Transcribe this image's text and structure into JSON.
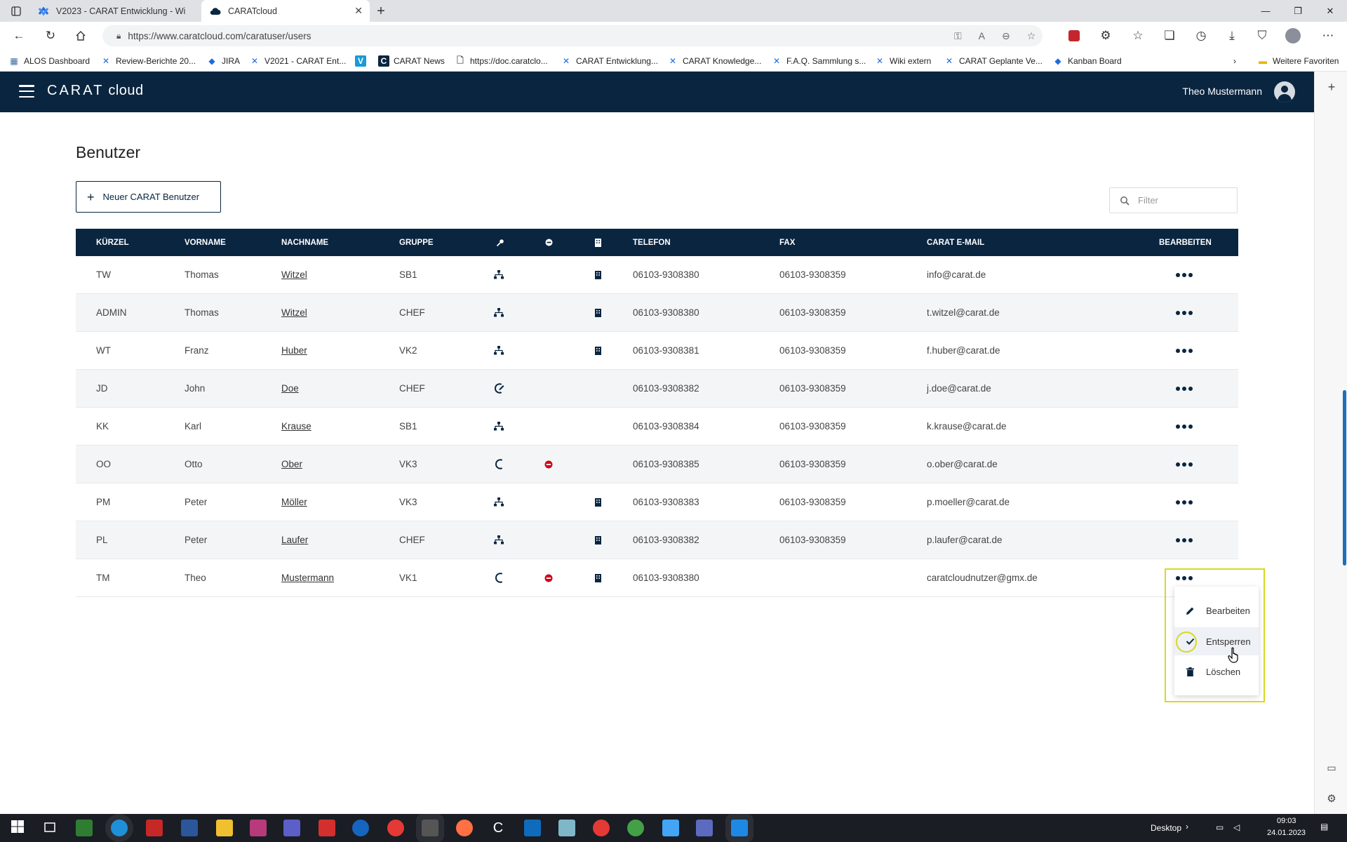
{
  "browser": {
    "tabs": [
      {
        "title": "V2023 - CARAT Entwicklung - Wi",
        "active": false
      },
      {
        "title": "CARATcloud",
        "active": true
      }
    ],
    "url": "https://www.caratcloud.com/caratuser/users",
    "favorites": [
      {
        "label": "ALOS Dashboard"
      },
      {
        "label": "Review-Berichte 20..."
      },
      {
        "label": "JIRA"
      },
      {
        "label": "V2021 - CARAT Ent..."
      },
      {
        "label": "CARAT News"
      },
      {
        "label": "https://doc.caratclo..."
      },
      {
        "label": "CARAT Entwicklung..."
      },
      {
        "label": "CARAT Knowledge..."
      },
      {
        "label": "F.A.Q. Sammlung s..."
      },
      {
        "label": "Wiki extern"
      },
      {
        "label": "CARAT Geplante Ve..."
      },
      {
        "label": "Kanban Board"
      }
    ],
    "other_favorites": "Weitere Favoriten"
  },
  "app": {
    "logo": "CARAT",
    "logo_suffix": "cloud",
    "user_name": "Theo Mustermann"
  },
  "page": {
    "title": "Benutzer",
    "new_button": "Neuer CARAT Benutzer",
    "filter_placeholder": "Filter"
  },
  "table": {
    "headers": {
      "kuerzel": "KÜRZEL",
      "vorname": "VORNAME",
      "nachname": "NACHNAME",
      "gruppe": "GRUPPE",
      "telefon": "TELEFON",
      "fax": "FAX",
      "email": "CARAT E-MAIL",
      "bearbeiten": "BEARBEITEN"
    },
    "rows": [
      {
        "kuerzel": "TW",
        "vorname": "Thomas",
        "nachname": "Witzel",
        "gruppe": "SB1",
        "role_icon": "network",
        "blocked": false,
        "building": true,
        "telefon": "06103-9308380",
        "fax": "06103-9308359",
        "email": "info@carat.de"
      },
      {
        "kuerzel": "ADMIN",
        "vorname": "Thomas",
        "nachname": "Witzel",
        "gruppe": "CHEF",
        "role_icon": "network",
        "blocked": false,
        "building": true,
        "telefon": "06103-9308380",
        "fax": "06103-9308359",
        "email": "t.witzel@carat.de"
      },
      {
        "kuerzel": "WT",
        "vorname": "Franz",
        "nachname": "Huber",
        "gruppe": "VK2",
        "role_icon": "network",
        "blocked": false,
        "building": true,
        "telefon": "06103-9308381",
        "fax": "06103-9308359",
        "email": "f.huber@carat.de"
      },
      {
        "kuerzel": "JD",
        "vorname": "John",
        "nachname": "Doe",
        "gruppe": "CHEF",
        "role_icon": "phone-edit",
        "blocked": false,
        "building": false,
        "telefon": "06103-9308382",
        "fax": "06103-9308359",
        "email": "j.doe@carat.de"
      },
      {
        "kuerzel": "KK",
        "vorname": "Karl",
        "nachname": "Krause",
        "gruppe": "SB1",
        "role_icon": "network",
        "blocked": false,
        "building": false,
        "telefon": "06103-9308384",
        "fax": "06103-9308359",
        "email": "k.krause@carat.de"
      },
      {
        "kuerzel": "OO",
        "vorname": "Otto",
        "nachname": "Ober",
        "gruppe": "VK3",
        "role_icon": "phone",
        "blocked": true,
        "building": false,
        "telefon": "06103-9308385",
        "fax": "06103-9308359",
        "email": "o.ober@carat.de"
      },
      {
        "kuerzel": "PM",
        "vorname": "Peter",
        "nachname": "Möller",
        "gruppe": "VK3",
        "role_icon": "network",
        "blocked": false,
        "building": true,
        "telefon": "06103-9308383",
        "fax": "06103-9308359",
        "email": "p.moeller@carat.de"
      },
      {
        "kuerzel": "PL",
        "vorname": "Peter",
        "nachname": "Laufer",
        "gruppe": "CHEF",
        "role_icon": "network",
        "blocked": false,
        "building": true,
        "telefon": "06103-9308382",
        "fax": "06103-9308359",
        "email": "p.laufer@carat.de"
      },
      {
        "kuerzel": "TM",
        "vorname": "Theo",
        "nachname": "Mustermann",
        "gruppe": "VK1",
        "role_icon": "phone",
        "blocked": true,
        "building": true,
        "telefon": "06103-9308380",
        "fax": "",
        "email": "caratcloudnutzer@gmx.de"
      }
    ]
  },
  "context_menu": {
    "items": [
      {
        "label": "Bearbeiten",
        "icon": "pencil-icon"
      },
      {
        "label": "Entsperren",
        "icon": "check-icon"
      },
      {
        "label": "Löschen",
        "icon": "trash-icon"
      }
    ]
  },
  "taskbar": {
    "desktop_label": "Desktop",
    "time": "09:03",
    "date": "24.01.2023"
  },
  "colors": {
    "navy": "#0a2540",
    "blocked_red": "#d0021b",
    "highlight_yellow": "#d8d822"
  }
}
